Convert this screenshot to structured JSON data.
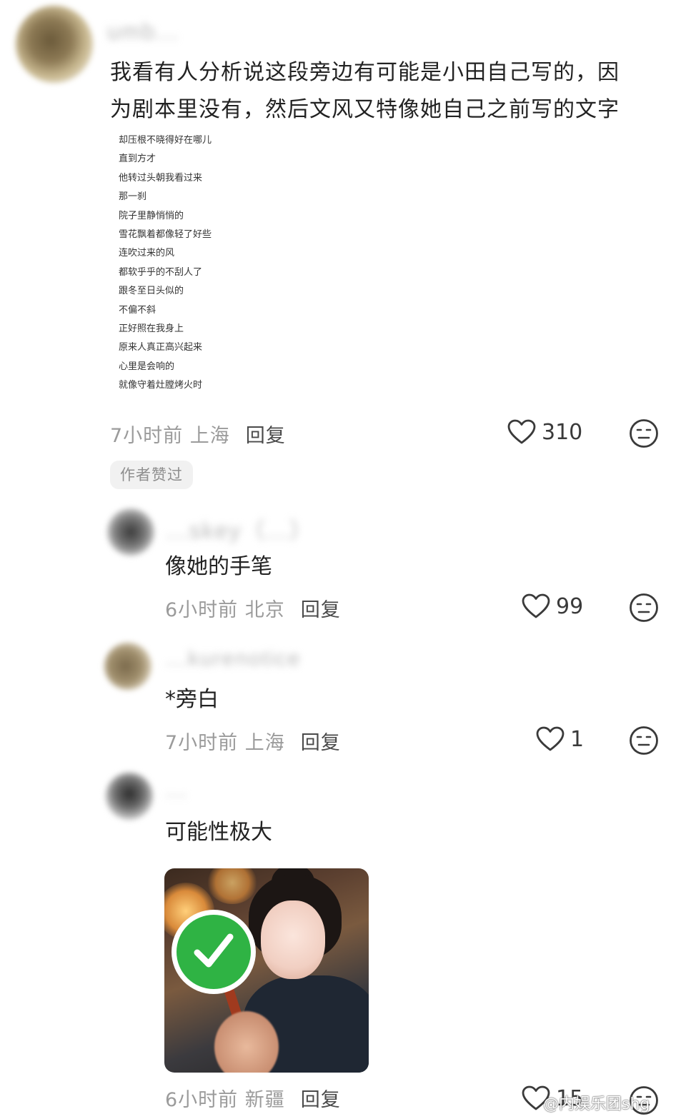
{
  "main_comment": {
    "username": "umb...",
    "text_line1": "我看有人分析说这段旁边有可能是小田自己写的，因",
    "text_line2": "为剧本里没有，然后文风又特像她自己之前写的文字",
    "quoted_lines": [
      "却压根不晓得好在哪儿",
      "直到方才",
      "他转过头朝我看过来",
      "那一刹",
      "院子里静悄悄的",
      "雪花飘着都像轻了好些",
      "连吹过来的风",
      "都软乎乎的不刮人了",
      "跟冬至日头似的",
      "不偏不斜",
      "正好照在我身上",
      "原来人真正高兴起来",
      "心里是会响的",
      "就像守着灶膛烤火时"
    ],
    "time_location": "7小时前 上海",
    "reply_label": "回复",
    "likes": "310",
    "badge": "作者赞过"
  },
  "replies": [
    {
      "username": "...skey（...）",
      "text": "像她的手笔",
      "time_location": "6小时前 北京",
      "reply_label": "回复",
      "likes": "99"
    },
    {
      "username": "...kurenotice",
      "text": "*旁白",
      "time_location": "7小时前 上海",
      "reply_label": "回复",
      "likes": "1"
    },
    {
      "username": "...",
      "text": "可能性极大",
      "time_location": "6小时前 新疆",
      "reply_label": "回复",
      "likes": "15"
    }
  ],
  "watermark": "@内娱乐团shg",
  "colors": {
    "meta_gray": "#9b9b9b",
    "reply_dark": "#4a4a4a",
    "badge_bg": "#f1f1f1",
    "check_green": "#2fb344"
  },
  "icons": {
    "like": "heart-outline-icon",
    "reaction": "neutral-face-icon",
    "sticker_check": "check-mark-icon"
  }
}
